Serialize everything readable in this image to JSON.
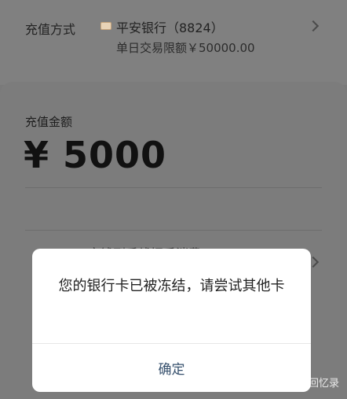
{
  "payment_method": {
    "label": "充值方式",
    "bank_name": "平安银行（8824）",
    "limit_text": "单日交易限额￥50000.00"
  },
  "recharge": {
    "amount_label": "充值金额",
    "amount_value": "¥ 5000",
    "obscured_row": "工文钱到手线招手消费"
  },
  "dialog": {
    "message": "您的银行卡已被冻结，请尝试其他卡",
    "confirm_label": "确定"
  },
  "watermark": "知乎 @币商回忆录",
  "colors": {
    "dialog_button": "#36506d",
    "overlay": "#7a7a7a"
  }
}
